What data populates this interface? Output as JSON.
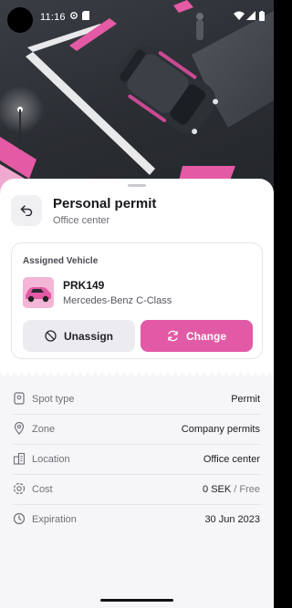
{
  "status_bar": {
    "time": "11:16",
    "icons": [
      "gear-icon",
      "sim-icon",
      "wifi-icon",
      "signal-icon",
      "battery-icon"
    ]
  },
  "hero": {
    "image": "car-in-parking-spot",
    "car_color": "#2c3136",
    "stripe_color": "#e45aa5"
  },
  "header": {
    "title": "Personal permit",
    "subtitle": "Office center"
  },
  "vehicle_card": {
    "heading": "Assigned Vehicle",
    "plate": "PRK149",
    "model": "Mercedes-Benz C-Class",
    "unassign_label": "Unassign",
    "change_label": "Change"
  },
  "details": [
    {
      "icon": "spot-icon",
      "label": "Spot type",
      "value": "Permit"
    },
    {
      "icon": "location-pin-icon",
      "label": "Zone",
      "value": "Company permits"
    },
    {
      "icon": "building-icon",
      "label": "Location",
      "value": "Office center"
    },
    {
      "icon": "cost-icon",
      "label": "Cost",
      "value": "0 SEK",
      "value_sub": "/ Free"
    },
    {
      "icon": "clock-icon",
      "label": "Expiration",
      "value": "30 Jun 2023"
    }
  ],
  "colors": {
    "accent": "#e25aa5",
    "secondary_button": "#ececf0",
    "details_background": "#f6f6f8"
  }
}
